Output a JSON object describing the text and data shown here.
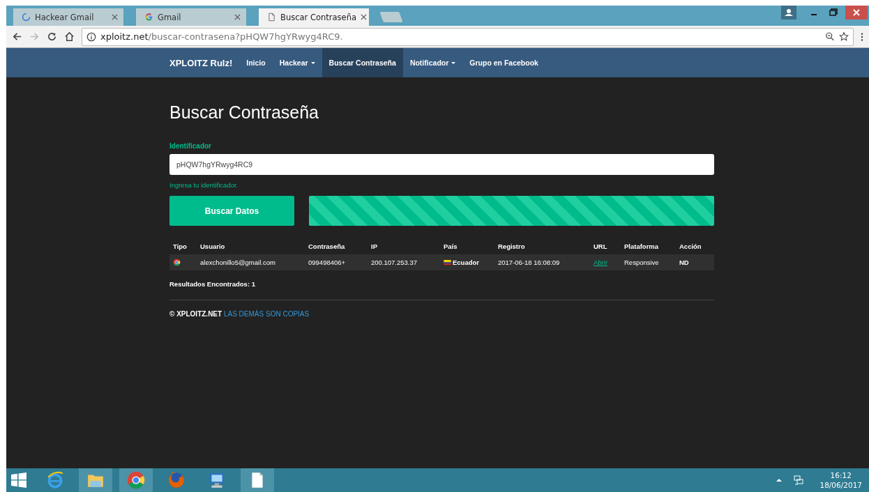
{
  "browser": {
    "tabs": [
      {
        "title": "Hackear Gmail",
        "kind": "loading",
        "selected": false
      },
      {
        "title": "Gmail",
        "kind": "google",
        "selected": false
      },
      {
        "title": "Buscar Contraseña",
        "kind": "page",
        "selected": true
      }
    ],
    "address": {
      "host": "xploitz.net",
      "path": "/buscar-contrasena?pHQW7hgYRwyg4RC9."
    }
  },
  "navbar": {
    "brand": "XPLOITZ Rulz!",
    "items": [
      {
        "label": "Inicio",
        "dropdown": false,
        "selected": false
      },
      {
        "label": "Hackear",
        "dropdown": true,
        "selected": false
      },
      {
        "label": "Buscar Contraseña",
        "dropdown": false,
        "selected": true
      },
      {
        "label": "Notificador",
        "dropdown": true,
        "selected": false
      },
      {
        "label": "Grupo en Facebook",
        "dropdown": false,
        "selected": false
      }
    ]
  },
  "heading": "Buscar Contraseña",
  "form": {
    "label": "Identificador",
    "value": "pHQW7hgYRwyg4RC9",
    "help": "Ingresa tu identificador.",
    "button": "Buscar Datos",
    "progress": {
      "level": 1
    }
  },
  "table": {
    "columns": [
      "Tipo",
      "Usuario",
      "Contraseña",
      "IP",
      "País",
      "Registro",
      "URL",
      "Plataforma",
      "Acción"
    ],
    "rows": [
      {
        "kind": "google",
        "usuario": "alexchonillo5@gmail.com",
        "contrasena": "099498406+",
        "ip": "200.107.253.37",
        "pais": "Ecuador",
        "registro": "2017-06-18 16:08:09",
        "url": "Abrir",
        "plataforma": "Responsive",
        "accion": "ND"
      }
    ]
  },
  "results": "Resultados Encontrados: 1",
  "footer": {
    "brand": "© XPLOITZ.NET",
    "link": "LAS DEMÁS SON COPIAS"
  },
  "taskbar": {
    "apps": [
      {
        "kind": "ie",
        "open": false
      },
      {
        "kind": "folder",
        "open": true
      },
      {
        "kind": "chrome",
        "open": true
      },
      {
        "kind": "firefox",
        "open": false
      },
      {
        "kind": "computer",
        "open": false
      },
      {
        "kind": "document",
        "open": true
      }
    ],
    "time": "16:12",
    "date": "18/06/2017"
  }
}
